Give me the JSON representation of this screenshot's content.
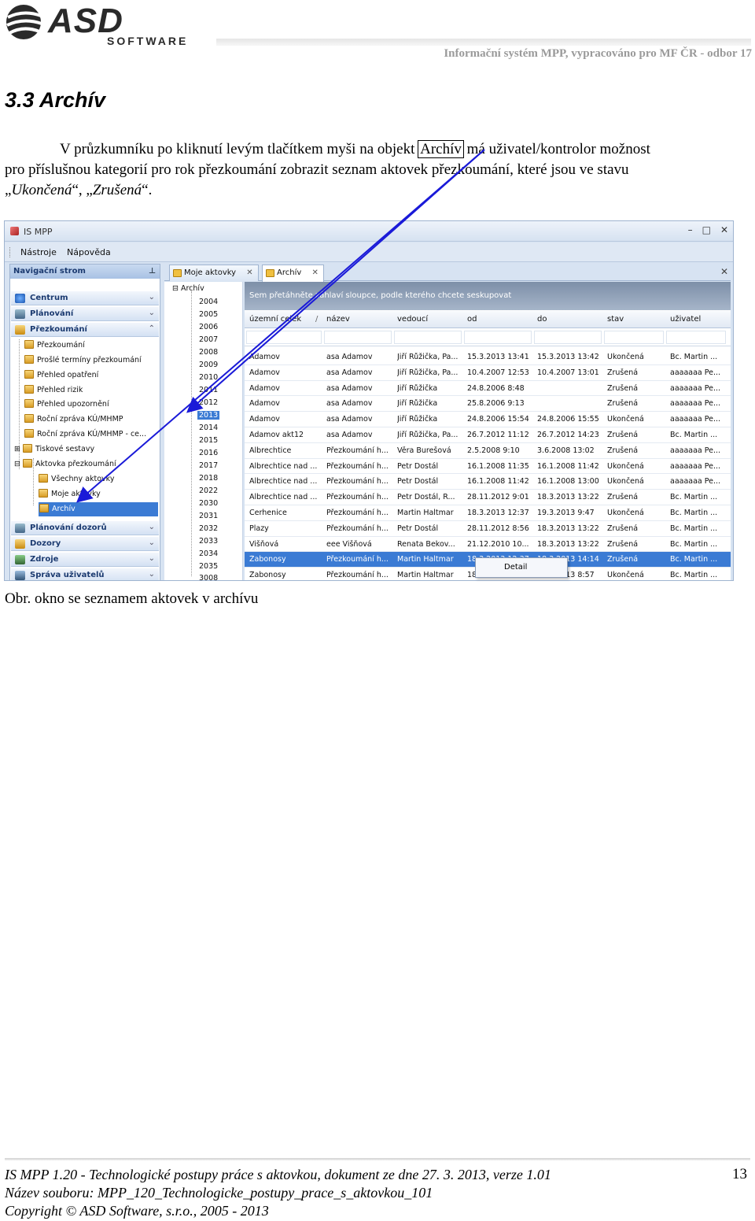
{
  "header": {
    "logo_text": "ASD",
    "logo_sub": "SOFTWARE",
    "info": "Informační systém MPP, vypracováno pro MF ČR - odbor 17"
  },
  "section": {
    "heading": "3.3 Archív"
  },
  "paragraph": {
    "part1": "V průzkumníku po kliknutí levým tlačítkem myši na objekt",
    "boxed": "Archív",
    "part2": "má uživatel/kontrolor možnost",
    "line2": "pro příslušnou kategorií pro rok přezkoumání zobrazit seznam aktovek přezkoumání, které jsou ve stavu",
    "line3_q1": "„",
    "italic1": "Ukončená",
    "line3_mid": "“, „",
    "italic2": "Zrušená",
    "line3_end": "“."
  },
  "screenshot": {
    "app_title": "IS MPP",
    "window_buttons": [
      "–",
      "□",
      "✕"
    ],
    "menu": [
      "Nástroje",
      "Nápověda"
    ],
    "nav_title": "Navigační strom",
    "nav_pin": "ᵖ",
    "groups_top": [
      "Centrum",
      "Plánování",
      "Přezkoumání"
    ],
    "tree": [
      "Přezkoumání",
      "Prošlé termíny přezkoumání",
      "Přehled opatření",
      "Přehled rizik",
      "Přehled upozornění",
      "Roční zpráva KÚ/MHMP",
      "Roční zpráva KÚ/MHMP - ce...",
      "Tiskové sestavy",
      "Aktovka přezkoumání",
      "Všechny aktovky",
      "Moje aktovky",
      "Archív"
    ],
    "groups_bottom": [
      "Plánování dozorů",
      "Dozory",
      "Zdroje",
      "Správa uživatelů"
    ],
    "tabs": [
      "Moje aktovky",
      "Archív"
    ],
    "tab_close": "✕",
    "archive_root": "Archív",
    "years": [
      "2004",
      "2005",
      "2006",
      "2007",
      "2008",
      "2009",
      "2010",
      "2011",
      "2012",
      "2013",
      "2014",
      "2015",
      "2016",
      "2017",
      "2018",
      "2022",
      "2030",
      "2031",
      "2032",
      "2033",
      "2034",
      "2035",
      "3008"
    ],
    "selected_year": "2013",
    "group_hint": "Sem přetáhněte záhlaví sloupce, podle kterého chcete seskupovat",
    "columns": [
      "územní celek",
      "název",
      "vedoucí",
      "od",
      "do",
      "stav",
      "uživatel"
    ],
    "rows": [
      [
        "Adamov",
        "asa Adamov",
        "Jiří Růžička, Pa...",
        "15.3.2013 13:41",
        "15.3.2013 13:42",
        "Ukončená",
        "Bc. Martin ..."
      ],
      [
        "Adamov",
        "asa Adamov",
        "Jiří Růžička, Pa...",
        "10.4.2007 12:53",
        "10.4.2007 13:01",
        "Zrušená",
        "aaaaaaa Pe..."
      ],
      [
        "Adamov",
        "asa Adamov",
        "Jiří Růžička",
        "24.8.2006 8:48",
        "",
        "Zrušená",
        "aaaaaaa Pe..."
      ],
      [
        "Adamov",
        "asa Adamov",
        "Jiří Růžička",
        "25.8.2006 9:13",
        "",
        "Zrušená",
        "aaaaaaa Pe..."
      ],
      [
        "Adamov",
        "asa Adamov",
        "Jiří Růžička",
        "24.8.2006 15:54",
        "24.8.2006 15:55",
        "Ukončená",
        "aaaaaaa Pe..."
      ],
      [
        "Adamov akt12",
        "asa Adamov",
        "Jiří Růžička, Pa...",
        "26.7.2012 11:12",
        "26.7.2012 14:23",
        "Zrušená",
        "Bc. Martin ..."
      ],
      [
        "Albrechtice",
        "Přezkoumání h...",
        "Věra Burešová",
        "2.5.2008 9:10",
        "3.6.2008 13:02",
        "Zrušená",
        "aaaaaaa Pe..."
      ],
      [
        "Albrechtice nad ...",
        "Přezkoumání h...",
        "Petr Dostál",
        "16.1.2008 11:35",
        "16.1.2008 11:42",
        "Ukončená",
        "aaaaaaa Pe..."
      ],
      [
        "Albrechtice nad ...",
        "Přezkoumání h...",
        "Petr Dostál",
        "16.1.2008 11:42",
        "16.1.2008 13:00",
        "Ukončená",
        "aaaaaaa Pe..."
      ],
      [
        "Albrechtice nad ...",
        "Přezkoumání h...",
        "Petr Dostál, R...",
        "28.11.2012 9:01",
        "18.3.2013 13:22",
        "Zrušená",
        "Bc. Martin ..."
      ],
      [
        "Cerhenice",
        "Přezkoumání h...",
        "Martin Haltmar",
        "18.3.2013 12:37",
        "19.3.2013 9:47",
        "Ukončená",
        "Bc. Martin ..."
      ],
      [
        "Plazy",
        "Přezkoumání h...",
        "Petr Dostál",
        "28.11.2012 8:56",
        "18.3.2013 13:22",
        "Zrušená",
        "Bc. Martin ..."
      ],
      [
        "Višňová",
        "eee Višňová",
        "Renata Bekov...",
        "21.12.2010 10...",
        "18.3.2013 13:22",
        "Zrušená",
        "Bc. Martin ..."
      ],
      [
        "Žabonosy",
        "Přezkoumání h...",
        "Martin Haltmar",
        "18.3.2013 12:37",
        "18.3.2013 14:14",
        "Zrušená",
        "Bc. Martin ..."
      ],
      [
        "Žabonosy",
        "Přezkoumání h...",
        "Martin Haltmar",
        "18.",
        "18.3.2013 8:57",
        "Ukončená",
        "Bc. Martin ..."
      ]
    ],
    "selected_row": 13,
    "context_menu": "Detail"
  },
  "caption": "Obr. okno se seznamem aktovek v archívu",
  "footer": {
    "line1": "IS MPP 1.20 - Technologické postupy práce s aktovkou, dokument ze dne 27. 3. 2013, verze 1.01",
    "line2": "Název souboru: MPP_120_Technologicke_postupy_prace_s_aktovkou_101",
    "line3": "Copyright © ASD Software, s.r.o., 2005 - 2013",
    "page": "13"
  },
  "colors": {
    "selection": "#3b7bd4",
    "arrow": "#1a1ad8"
  }
}
